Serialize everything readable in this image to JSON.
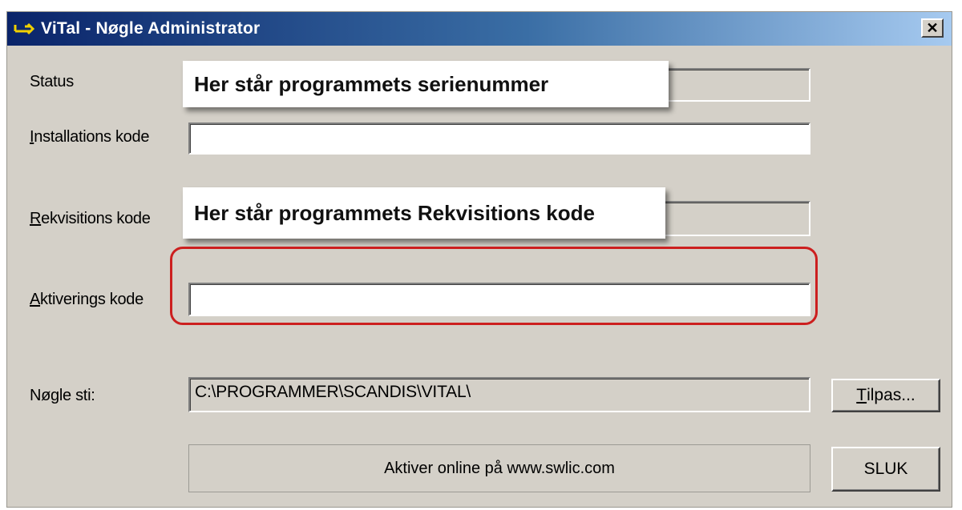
{
  "window": {
    "title": "ViTal - Nøgle Administrator",
    "close_label": "✕"
  },
  "labels": {
    "status": "Status",
    "installation": "Installations kode",
    "installation_key": "I",
    "installation_rest": "nstallations kode",
    "rekvisition_key": "R",
    "rekvisition_rest": "ekvisitions kode",
    "aktivering_key": "A",
    "aktivering_rest": "ktiverings kode",
    "noegle_sti": "Nøgle sti:"
  },
  "fields": {
    "installation_value": "",
    "aktivering_value": "",
    "noegle_sti_value": "C:\\PROGRAMMER\\SCANDIS\\VITAL\\"
  },
  "callouts": {
    "serial": "Her står programmets serienummer",
    "rekvisition": "Her står programmets Rekvisitions kode"
  },
  "buttons": {
    "tilpas_key": "T",
    "tilpas_rest": "ilpas...",
    "activate_online": "Aktiver online på www.swlic.com",
    "sluk": "SLUK"
  },
  "colors": {
    "highlight": "#cc1f1f",
    "titlebar_start": "#0a246a",
    "titlebar_end": "#a6caf0"
  },
  "icons": {
    "app": "vital-key-icon",
    "close": "close-icon"
  }
}
